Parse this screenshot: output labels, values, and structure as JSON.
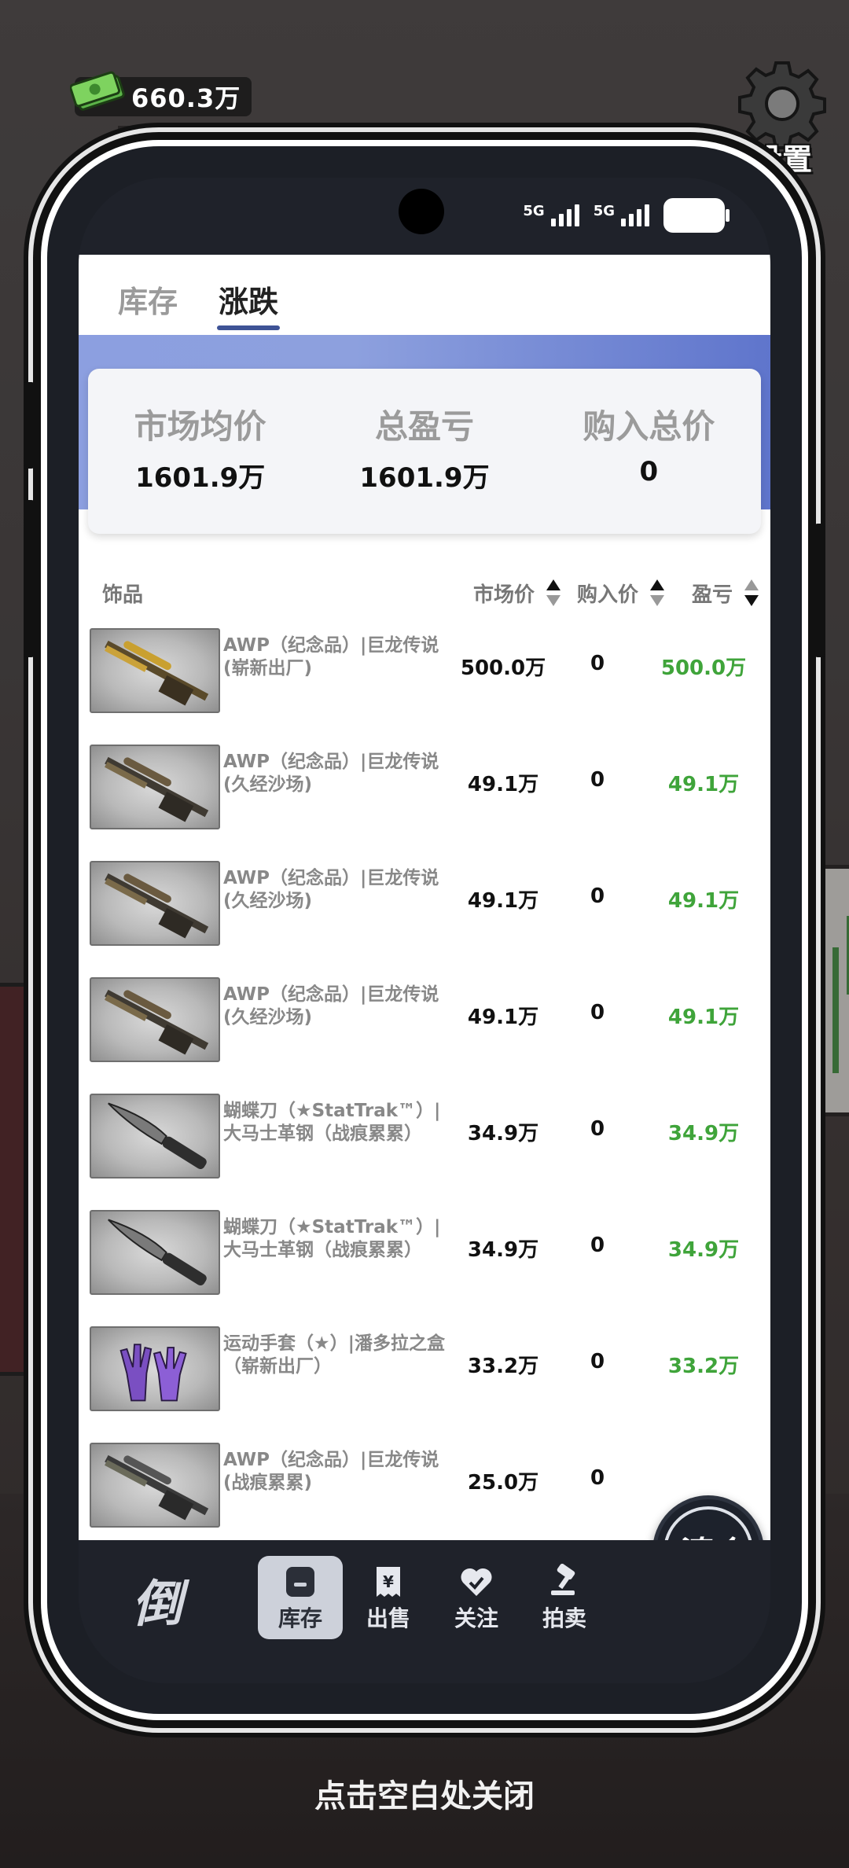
{
  "hud": {
    "money": "660.3万",
    "settings_label": "设置"
  },
  "status_bar": {
    "sim1": "5G",
    "sim2": "5G"
  },
  "tabs": [
    {
      "label": "库存",
      "active": false
    },
    {
      "label": "涨跌",
      "active": true
    }
  ],
  "summary": {
    "market_avg_label": "市场均价",
    "market_avg": "1601.9万",
    "total_pnl_label": "总盈亏",
    "total_pnl": "1601.9万",
    "buy_total_label": "购入总价",
    "buy_total": "0"
  },
  "table": {
    "col_item": "饰品",
    "col_price": "市场价",
    "col_cost": "购入价",
    "col_profit": "盈亏",
    "rows": [
      {
        "name": "AWP（纪念品）|巨龙传说(崭新出厂)",
        "price": "500.0万",
        "cost": "0",
        "profit": "500.0万",
        "thumb": "rifle-gold"
      },
      {
        "name": "AWP（纪念品）|巨龙传说(久经沙场)",
        "price": "49.1万",
        "cost": "0",
        "profit": "49.1万",
        "thumb": "rifle"
      },
      {
        "name": "AWP（纪念品）|巨龙传说(久经沙场)",
        "price": "49.1万",
        "cost": "0",
        "profit": "49.1万",
        "thumb": "rifle"
      },
      {
        "name": "AWP（纪念品）|巨龙传说(久经沙场)",
        "price": "49.1万",
        "cost": "0",
        "profit": "49.1万",
        "thumb": "rifle"
      },
      {
        "name": "蝴蝶刀（★StatTrak™）|大马士革钢（战痕累累）",
        "price": "34.9万",
        "cost": "0",
        "profit": "34.9万",
        "thumb": "knife"
      },
      {
        "name": "蝴蝶刀（★StatTrak™）|大马士革钢（战痕累累）",
        "price": "34.9万",
        "cost": "0",
        "profit": "34.9万",
        "thumb": "knife"
      },
      {
        "name": "运动手套（★）|潘多拉之盒（崭新出厂）",
        "price": "33.2万",
        "cost": "0",
        "profit": "33.2万",
        "thumb": "gloves"
      },
      {
        "name": "AWP（纪念品）|巨龙传说(战痕累累)",
        "price": "25.0万",
        "cost": "0",
        "profit": "",
        "thumb": "rifle-dark"
      }
    ]
  },
  "clear_button": "清仓",
  "nav": {
    "logo": "倒",
    "items": [
      {
        "label": "库存",
        "icon": "inventory-icon",
        "active": true
      },
      {
        "label": "出售",
        "icon": "sell-tag-icon",
        "active": false
      },
      {
        "label": "关注",
        "icon": "heart-icon",
        "active": false
      },
      {
        "label": "拍卖",
        "icon": "gavel-icon",
        "active": false
      }
    ]
  },
  "close_hint": "点击空白处关闭",
  "colors": {
    "profit": "#3fa43a",
    "accent": "#3e5396",
    "nav_bg": "#1f222a"
  }
}
